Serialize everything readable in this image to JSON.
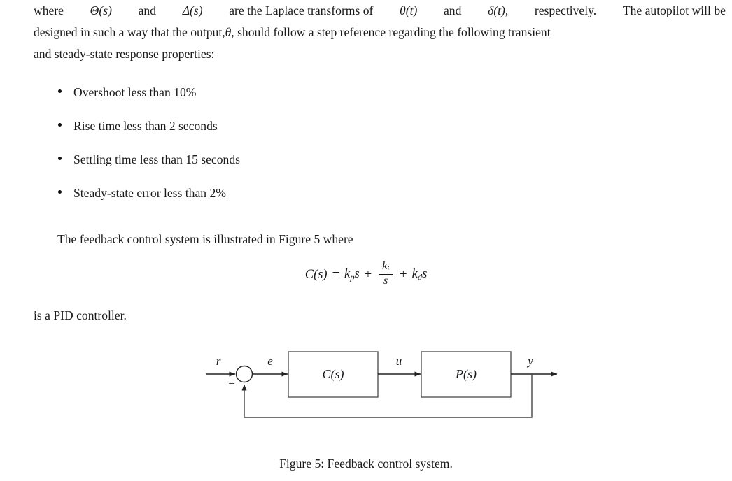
{
  "document": {
    "intro_paragraph": {
      "line1_left": "where",
      "line1_theta_s": "Θ(s)",
      "line1_and1": "and",
      "line1_delta_s": "Δ(s)",
      "line1_mid": "are the Laplace transforms of",
      "line1_theta_t": "θ(t)",
      "line1_and2": "and",
      "line1_delta_t": "δ(t),",
      "line1_end": "respectively.",
      "line1_tail": "The autopilot will be",
      "line2_pre": "designed in such a way that the output,",
      "line2_theta": "θ",
      "line2_post": ", should follow a step reference regarding the following transient",
      "line3": "and steady-state response properties:"
    },
    "requirements": [
      "Overshoot less than 10%",
      "Rise time less than 2 seconds",
      "Settling time less than 15 seconds",
      "Steady-state error less than 2%"
    ],
    "figure_intro": "The feedback control system is illustrated in Figure 5 where",
    "equation": {
      "lhs": "C(s)",
      "equals": "=",
      "term1_base": "k",
      "term1_sub": "p",
      "term1_var": "s",
      "plus1": "+",
      "frac_num_base": "k",
      "frac_num_sub": "i",
      "frac_den": "s",
      "plus2": "+",
      "term3_base": "k",
      "term3_sub": "d",
      "term3_var": "s"
    },
    "pid_paragraph": "is a PID controller.",
    "figure_caption": "Figure 5: Feedback control system."
  },
  "diagram": {
    "signal_r": "r",
    "signal_e": "e",
    "signal_u": "u",
    "signal_y": "y",
    "sum_minus": "−",
    "block_controller": "C(s)",
    "block_plant": "P(s)",
    "line_color": "#333333",
    "box_stroke": "#555555"
  }
}
